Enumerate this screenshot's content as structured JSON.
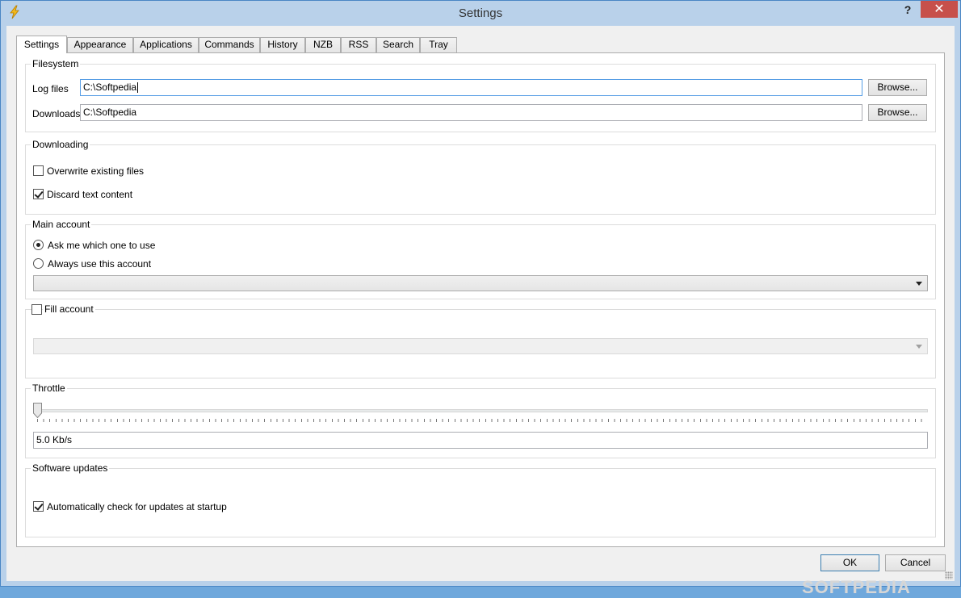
{
  "window": {
    "title": "Settings",
    "help": "?",
    "close": "✕"
  },
  "tabs": [
    {
      "label": "Settings",
      "active": true
    },
    {
      "label": "Appearance"
    },
    {
      "label": "Applications"
    },
    {
      "label": "Commands"
    },
    {
      "label": "History"
    },
    {
      "label": "NZB"
    },
    {
      "label": "RSS"
    },
    {
      "label": "Search"
    },
    {
      "label": "Tray"
    }
  ],
  "filesystem": {
    "title": "Filesystem",
    "log_label": "Log files",
    "log_value": "C:\\Softpedia",
    "downloads_label": "Downloads",
    "downloads_value": "C:\\Softpedia",
    "browse": "Browse..."
  },
  "downloading": {
    "title": "Downloading",
    "overwrite": {
      "label": "Overwrite existing files",
      "checked": false
    },
    "discard": {
      "label": "Discard text content",
      "checked": true
    }
  },
  "main_account": {
    "title": "Main account",
    "ask": {
      "label": "Ask me which one to use",
      "selected": true
    },
    "always": {
      "label": "Always use this account",
      "selected": false
    },
    "account_select": ""
  },
  "fill_account": {
    "label": "Fill account",
    "checked": false,
    "account_select": ""
  },
  "throttle": {
    "title": "Throttle",
    "value": "5.0 Kb/s",
    "level": 0
  },
  "updates": {
    "title": "Software updates",
    "auto_check": {
      "label": "Automatically check for updates at startup",
      "checked": true
    }
  },
  "footer": {
    "ok": "OK",
    "cancel": "Cancel"
  },
  "watermark": "SOFTPEDIA",
  "colors": {
    "close": "#c7504b",
    "focus": "#569de5",
    "frame": "#b9d1ea"
  }
}
